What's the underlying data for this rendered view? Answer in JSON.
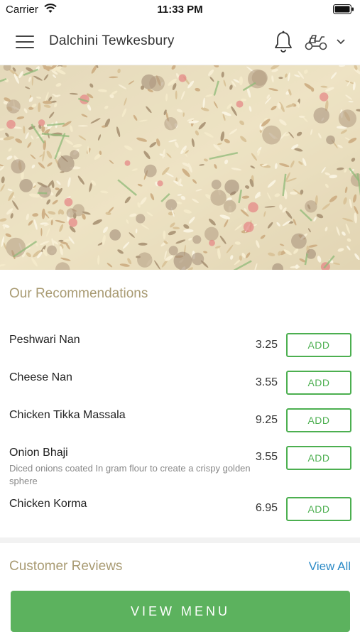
{
  "status_bar": {
    "carrier": "Carrier",
    "time": "11:33 PM"
  },
  "header": {
    "title": "Dalchini Tewkesbury"
  },
  "recommendations": {
    "title": "Our Recommendations",
    "add_label": "ADD",
    "items": [
      {
        "name": "Peshwari Nan",
        "price": "3.25",
        "description": ""
      },
      {
        "name": "Cheese Nan",
        "price": "3.55",
        "description": ""
      },
      {
        "name": "Chicken Tikka Massala",
        "price": "9.25",
        "description": ""
      },
      {
        "name": "Onion Bhaji",
        "price": "3.55",
        "description": "Diced onions coated In gram flour to create a crispy golden sphere"
      },
      {
        "name": "Chicken Korma",
        "price": "6.95",
        "description": ""
      }
    ]
  },
  "reviews": {
    "title": "Customer Reviews",
    "view_all": "View All"
  },
  "footer": {
    "view_menu": "VIEW MENU"
  },
  "colors": {
    "accent_green": "#5cb25e",
    "section_title": "#a99b73",
    "link_blue": "#2b8ac6"
  }
}
